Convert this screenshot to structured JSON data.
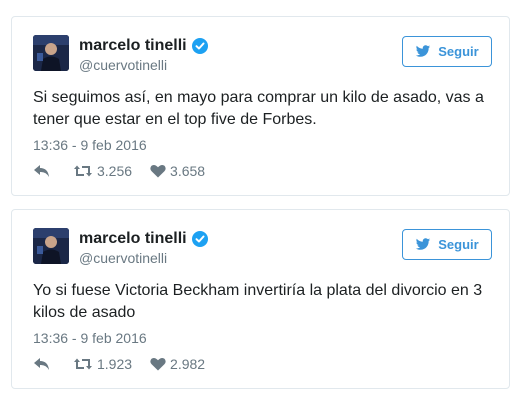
{
  "tweets": [
    {
      "name": "marcelo tinelli",
      "handle": "@cuervotinelli",
      "follow_label": "Seguir",
      "text": "Si seguimos así, en mayo para comprar un kilo de asado, vas a tener que estar en el top five de Forbes.",
      "timestamp": "13:36 - 9 feb 2016",
      "retweets": "3.256",
      "likes": "3.658"
    },
    {
      "name": "marcelo tinelli",
      "handle": "@cuervotinelli",
      "follow_label": "Seguir",
      "text": "Yo si fuese Victoria Beckham invertiría la plata del divorcio en 3 kilos de asado",
      "timestamp": "13:36 - 9 feb 2016",
      "retweets": "1.923",
      "likes": "2.982"
    }
  ],
  "colors": {
    "accent": "#3b94d9",
    "verified": "#1da1f2",
    "muted": "#697882",
    "border": "#e1e8ed"
  },
  "icons": [
    "verified-badge-icon",
    "bird-icon",
    "reply-icon",
    "retweet-icon",
    "heart-icon"
  ]
}
